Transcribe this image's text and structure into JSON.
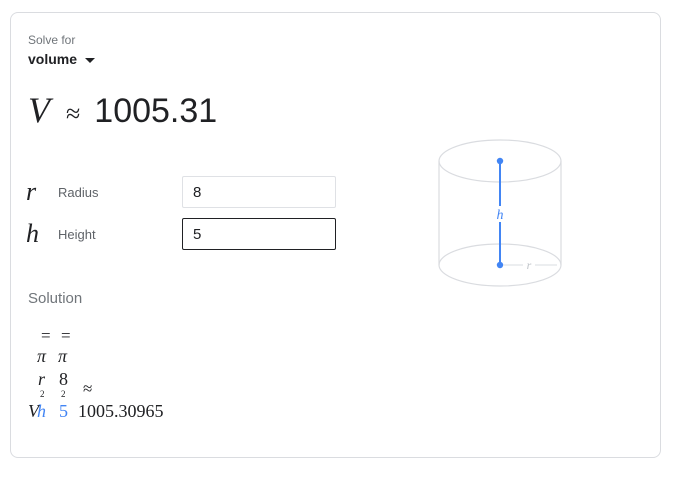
{
  "solve_for": {
    "label": "Solve for",
    "selected": "volume"
  },
  "result": {
    "variable": "V",
    "approx_symbol": "≈",
    "value": "1005.31"
  },
  "inputs": [
    {
      "symbol": "r",
      "label": "Radius",
      "value": "8"
    },
    {
      "symbol": "h",
      "label": "Height",
      "value": "5"
    }
  ],
  "solution": {
    "title": "Solution",
    "equals": "=",
    "pi": "π",
    "r_symbol": "r",
    "r_value": "8",
    "exponent": "2",
    "v_symbol": "V",
    "h_symbol": "h",
    "h_value": "5",
    "approx_symbol": "≈",
    "value": "1005.30965"
  },
  "diagram": {
    "h_label": "h",
    "r_label": "r"
  },
  "colors": {
    "accent": "#4285f4",
    "diagram_line": "#dadce0",
    "text": "#202124"
  }
}
